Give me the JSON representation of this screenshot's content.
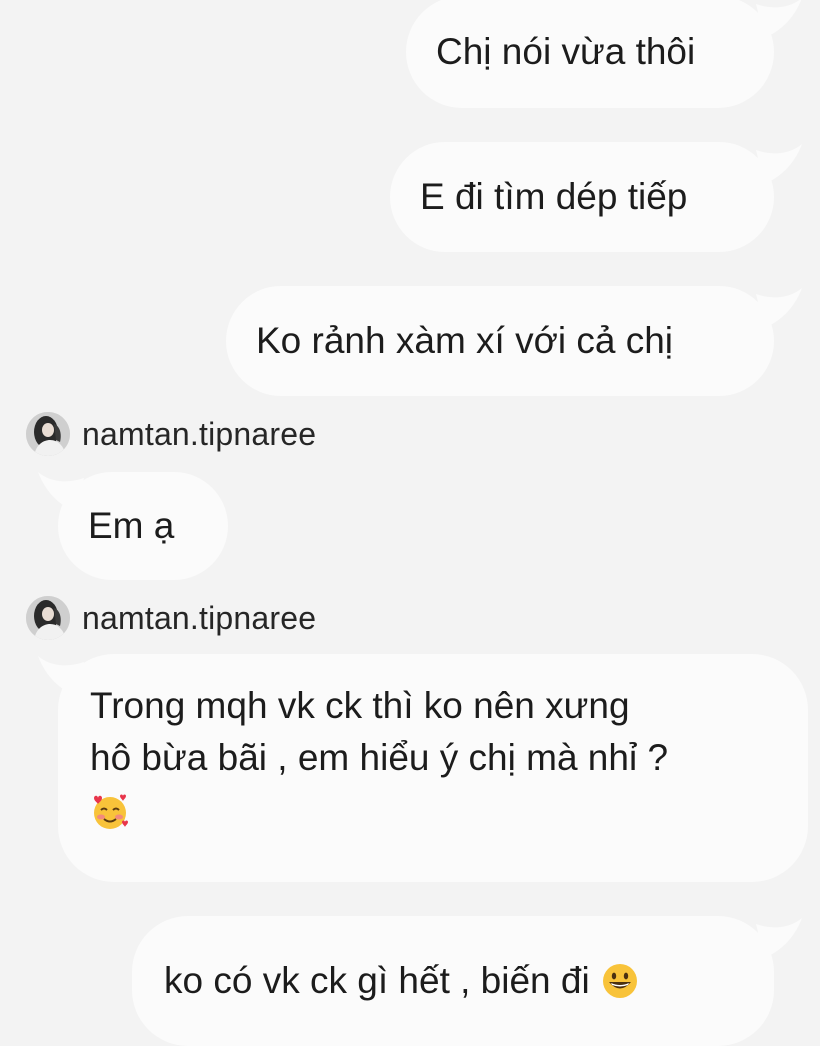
{
  "messages": [
    {
      "side": "outgoing",
      "text": "Chị nói vừa thôi"
    },
    {
      "side": "outgoing",
      "text": "E đi tìm dép tiếp"
    },
    {
      "side": "outgoing",
      "text": "Ko rảnh xàm xí với cả chị"
    },
    {
      "side": "incoming",
      "sender": "namtan.tipnaree",
      "text": "Em ạ"
    },
    {
      "side": "incoming",
      "sender": "namtan.tipnaree",
      "lines": [
        "Trong mqh vk ck thì ko nên xưng",
        "hô bừa bãi , em hiểu ý chị mà nhỉ ?"
      ],
      "emoji": "smiling-face-with-hearts"
    },
    {
      "side": "outgoing",
      "text": "ko có vk ck gì hết , biến đi",
      "emoji": "grinning-face"
    }
  ],
  "colors": {
    "background": "#f3f3f3",
    "bubble": "#fbfbfb",
    "text": "#1c1c1c"
  }
}
